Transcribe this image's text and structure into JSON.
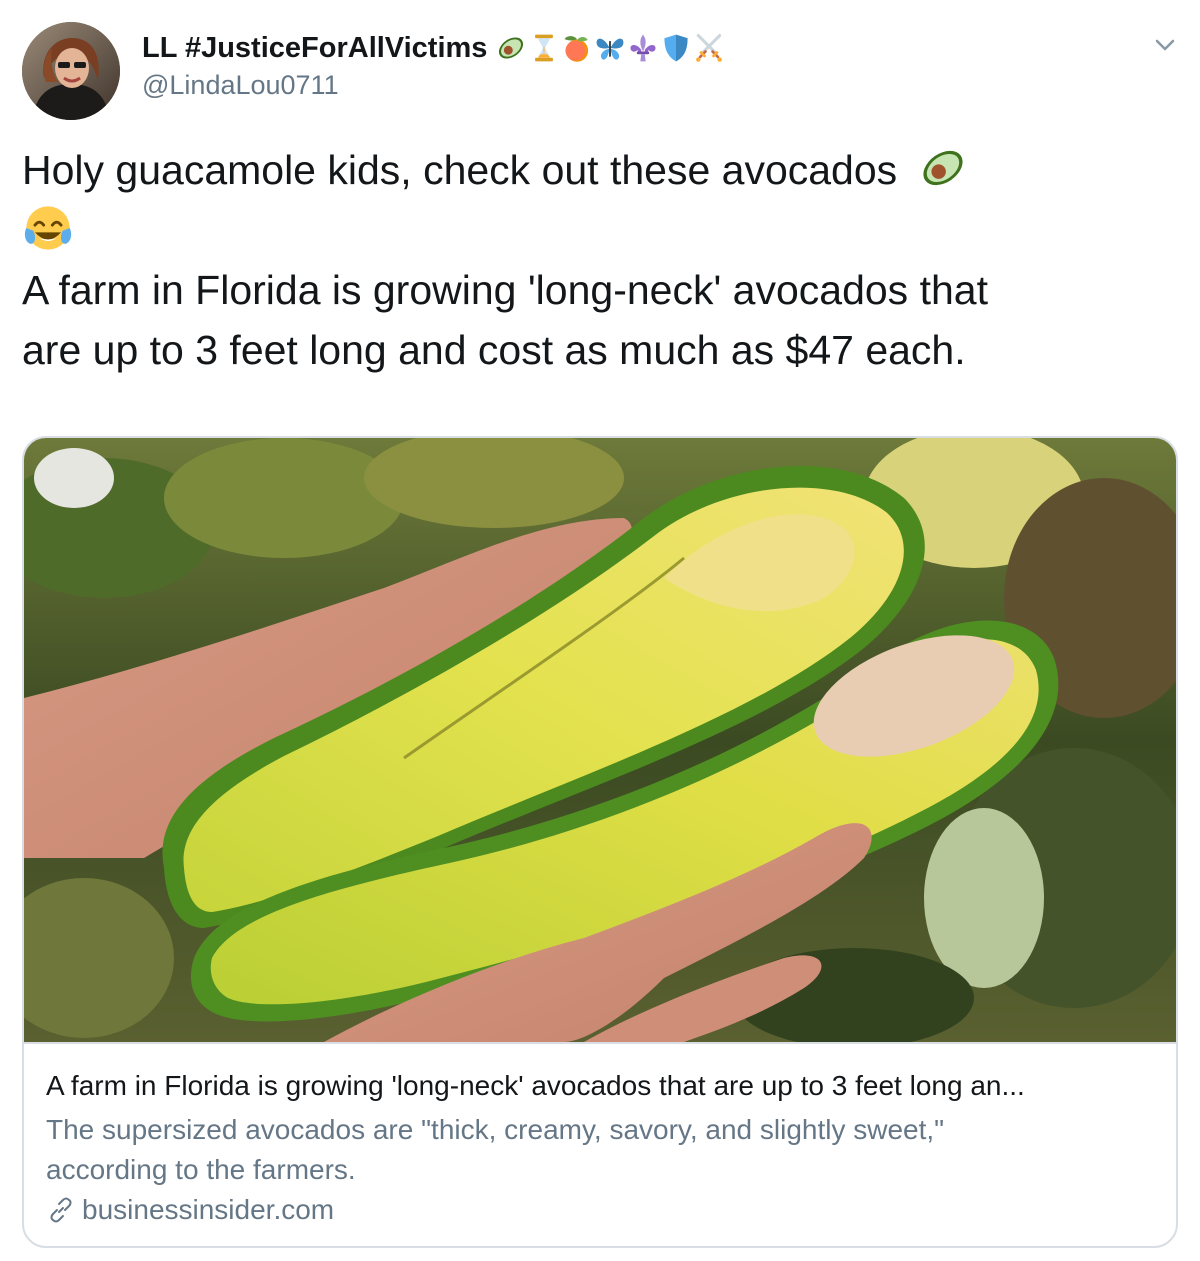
{
  "user": {
    "display_name": "LL #JusticeForAllVictims",
    "name_emojis": [
      "avocado-emoji",
      "hourglass-emoji",
      "peach-emoji",
      "butterfly-emoji",
      "fleur-de-lis-emoji",
      "shield-emoji",
      "crossed-swords-emoji"
    ],
    "handle": "@LindaLou0711"
  },
  "tweet": {
    "line1": "Holy guacamole kids, check out these avocados",
    "line1_emoji": "avocado-emoji",
    "line2_emoji": "tears-of-joy-emoji",
    "line3": "A farm in Florida is growing 'long-neck' avocados that",
    "line4": "are up to 3 feet long and cost as much as $47 each."
  },
  "card": {
    "title": "A farm in Florida is growing 'long-neck' avocados that are up to 3 feet long an...",
    "description_line1": "The supersized avocados are \"thick, creamy, savory, and slightly sweet,\"",
    "description_line2": "according to the farmers.",
    "domain": "businessinsider.com",
    "domain_icon": "link-icon"
  },
  "menu": {
    "icon": "chevron-down-icon"
  },
  "colors": {
    "text_primary": "#14171a",
    "text_secondary": "#657786",
    "border": "#d8dee3"
  }
}
